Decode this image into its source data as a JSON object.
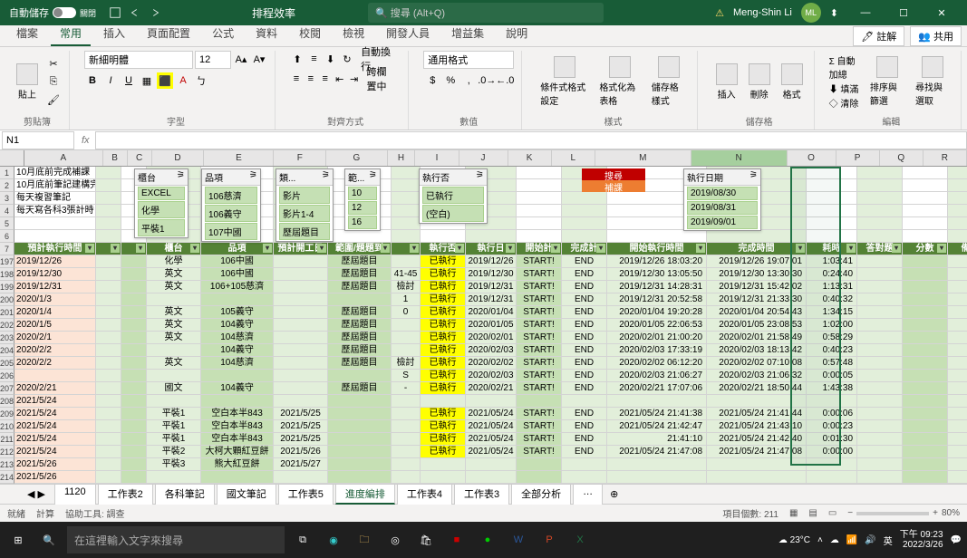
{
  "title": {
    "autosave": "自動儲存",
    "autosave_state": "關閉",
    "docname": "排程效率",
    "search": "搜尋 (Alt+Q)",
    "user": "Meng-Shin Li",
    "avatar": "ML"
  },
  "menutabs": [
    "檔案",
    "常用",
    "插入",
    "頁面配置",
    "公式",
    "資料",
    "校閱",
    "檢視",
    "開發人員",
    "增益集",
    "說明"
  ],
  "menuright": {
    "comment": "註解",
    "share": "共用"
  },
  "ribbon": {
    "clipboard": "剪貼簿",
    "paste": "貼上",
    "font_group": "字型",
    "font": "新細明體",
    "size": "12",
    "align_group": "對齊方式",
    "wrap": "自動換行",
    "merge": "跨欄置中",
    "number_group": "數值",
    "number_fmt": "通用格式",
    "styles_group": "樣式",
    "cond": "條件式格式設定",
    "tblfmt": "格式化為表格",
    "cellstyle": "儲存格樣式",
    "cells_group": "儲存格",
    "insert": "插入",
    "delete": "刪除",
    "format": "格式",
    "edit_group": "編輯",
    "autosum": "自動加總",
    "fill": "填滿",
    "clear": "清除",
    "sort": "排序與篩選",
    "find": "尋找與選取"
  },
  "namebox": "N1",
  "fx": "fx",
  "cols": [
    "A",
    "B",
    "C",
    "D",
    "E",
    "F",
    "G",
    "H",
    "I",
    "J",
    "K",
    "L",
    "M",
    "N",
    "O",
    "P",
    "Q",
    "R"
  ],
  "notes": [
    "10月底前完成補課",
    "10月底前筆記建構完",
    "每天複習筆記",
    "每天寫各科3張計時"
  ],
  "slicers": {
    "s1": {
      "title": "櫃台",
      "items": [
        "EXCEL",
        "化學",
        "平裝1"
      ]
    },
    "s2": {
      "title": "品項",
      "items": [
        "106慈濟",
        "106義守",
        "107中國"
      ]
    },
    "s3": {
      "title": "類...",
      "items": [
        "影片",
        "影片1-4",
        "歷屆題目"
      ]
    },
    "s4": {
      "title": "範...",
      "items": [
        "10",
        "12",
        "16"
      ]
    },
    "s5": {
      "title": "執行否",
      "items": [
        "已執行",
        "(空白)"
      ]
    },
    "s6": {
      "title": "執行日期",
      "items": [
        "2019/08/30",
        "2019/08/31",
        "2019/09/01"
      ]
    }
  },
  "red1": "搜尋",
  "red2": "補課",
  "headers": [
    "預計執行時間",
    "",
    "",
    "櫃台",
    "品項",
    "預計開工日",
    "範圍/題題到",
    "",
    "執行否",
    "執行日",
    "開始計",
    "完成計",
    "開始執行時間",
    "完成時間",
    "耗時",
    "答對題",
    "分數",
    "備註"
  ],
  "rownums": [
    "1",
    "2",
    "3",
    "4",
    "5",
    "6",
    "7",
    "197",
    "198",
    "199",
    "200",
    "201",
    "202",
    "203",
    "204",
    "205",
    "206",
    "207",
    "208",
    "209",
    "210",
    "211",
    "212",
    "213",
    "214"
  ],
  "rows": [
    {
      "a": "2019/12/26",
      "d": "化學",
      "e": "106中國",
      "f": "",
      "g": "歷屆題目",
      "h": "",
      "i": "已執行",
      "j": "2019/12/26",
      "k": "START!",
      "l": "END",
      "m": "2019/12/26 18:03:20",
      "n": "2019/12/26 19:07:01",
      "o": "1:03:41"
    },
    {
      "a": "2019/12/30",
      "d": "英文",
      "e": "106中國",
      "f": "",
      "g": "歷屆題目",
      "h": "41-45",
      "i": "已執行",
      "j": "2019/12/30",
      "k": "START!",
      "l": "END",
      "m": "2019/12/30 13:05:50",
      "n": "2019/12/30 13:30:30",
      "o": "0:24:40"
    },
    {
      "a": "2019/12/31",
      "d": "英文",
      "e": "106+105慈濟",
      "f": "",
      "g": "歷屆題目",
      "h": "檢討",
      "i": "已執行",
      "j": "2019/12/31",
      "k": "START!",
      "l": "END",
      "m": "2019/12/31 14:28:31",
      "n": "2019/12/31 15:42:02",
      "o": "1:13:31"
    },
    {
      "a": "2020/1/3",
      "d": "",
      "e": "",
      "f": "",
      "g": "",
      "h": "1",
      "i": "已執行",
      "j": "2019/12/31",
      "k": "START!",
      "l": "END",
      "m": "2019/12/31 20:52:58",
      "n": "2019/12/31 21:33:30",
      "o": "0:40:32"
    },
    {
      "a": "2020/1/4",
      "d": "英文",
      "e": "105義守",
      "f": "",
      "g": "歷屆題目",
      "h": "0",
      "i": "已執行",
      "j": "2020/01/04",
      "k": "START!",
      "l": "END",
      "m": "2020/01/04 19:20:28",
      "n": "2020/01/04 20:54:43",
      "o": "1:34:15"
    },
    {
      "a": "2020/1/5",
      "d": "英文",
      "e": "104義守",
      "f": "",
      "g": "歷屆題目",
      "h": "",
      "i": "已執行",
      "j": "2020/01/05",
      "k": "START!",
      "l": "END",
      "m": "2020/01/05 22:06:53",
      "n": "2020/01/05 23:08:53",
      "o": "1:02:00"
    },
    {
      "a": "2020/2/1",
      "d": "英文",
      "e": "104慈濟",
      "f": "",
      "g": "歷屆題目",
      "h": "",
      "i": "已執行",
      "j": "2020/02/01",
      "k": "START!",
      "l": "END",
      "m": "2020/02/01 21:00:20",
      "n": "2020/02/01 21:58:49",
      "o": "0:58:29"
    },
    {
      "a": "2020/2/2",
      "d": "",
      "e": "104義守",
      "f": "",
      "g": "歷屆題目",
      "h": "",
      "i": "已執行",
      "j": "2020/02/03",
      "k": "START!",
      "l": "END",
      "m": "2020/02/03 17:33:19",
      "n": "2020/02/03 18:13:42",
      "o": "0:40:23"
    },
    {
      "a": "2020/2/2",
      "d": "英文",
      "e": "104慈濟",
      "f": "",
      "g": "歷屆題目",
      "h": "檢討",
      "i": "已執行",
      "j": "2020/02/02",
      "k": "START!",
      "l": "END",
      "m": "2020/02/02 06:12:20",
      "n": "2020/02/02 07:10:08",
      "o": "0:57:48"
    },
    {
      "a": "",
      "d": "",
      "e": "",
      "f": "",
      "g": "",
      "h": "S",
      "i": "已執行",
      "j": "2020/02/03",
      "k": "START!",
      "l": "END",
      "m": "2020/02/03 21:06:27",
      "n": "2020/02/03 21:06:32",
      "o": "0:00:05"
    },
    {
      "a": "2020/2/21",
      "d": "國文",
      "e": "104義守",
      "f": "",
      "g": "歷屆題目",
      "h": "-",
      "i": "已執行",
      "j": "2020/02/21",
      "k": "START!",
      "l": "END",
      "m": "2020/02/21 17:07:06",
      "n": "2020/02/21 18:50:44",
      "o": "1:43:38"
    },
    {
      "a": "2021/5/24",
      "d": "",
      "e": "",
      "f": "",
      "g": "",
      "h": "",
      "i": "",
      "j": "",
      "k": "",
      "l": "",
      "m": "",
      "n": "",
      "o": ""
    },
    {
      "a": "2021/5/24",
      "d": "平裝1",
      "e": "空白本半843",
      "f": "2021/5/25",
      "g": "",
      "h": "",
      "i": "已執行",
      "j": "2021/05/24",
      "k": "START!",
      "l": "END",
      "m": "2021/05/24 21:41:38",
      "n": "2021/05/24 21:41:44",
      "o": "0:00:06"
    },
    {
      "a": "2021/5/24",
      "d": "平裝1",
      "e": "空白本半843",
      "f": "2021/5/25",
      "g": "",
      "h": "",
      "i": "已執行",
      "j": "2021/05/24",
      "k": "START!",
      "l": "END",
      "m": "2021/05/24 21:42:47",
      "n": "2021/05/24 21:43:10",
      "o": "0:00:23"
    },
    {
      "a": "2021/5/24",
      "d": "平裝1",
      "e": "空白本半843",
      "f": "2021/5/25",
      "g": "",
      "h": "",
      "i": "已執行",
      "j": "2021/05/24",
      "k": "START!",
      "l": "END",
      "m": "21:41:10",
      "n": "2021/05/24 21:42:40",
      "o": "0:01:30"
    },
    {
      "a": "2021/5/24",
      "d": "平裝2",
      "e": "大柯大顆紅豆餅",
      "f": "2021/5/26",
      "g": "",
      "h": "",
      "i": "已執行",
      "j": "2021/05/24",
      "k": "START!",
      "l": "END",
      "m": "2021/05/24 21:47:08",
      "n": "2021/05/24 21:47:08",
      "o": "0:00:00"
    },
    {
      "a": "2021/5/26",
      "d": "平裝3",
      "e": "熊大紅豆餅",
      "f": "2021/5/27",
      "g": "",
      "h": "",
      "i": "",
      "j": "",
      "k": "",
      "l": "",
      "m": "",
      "n": "",
      "o": ""
    },
    {
      "a": "2021/5/26",
      "d": "",
      "e": "",
      "f": "",
      "g": "",
      "h": "",
      "i": "",
      "j": "",
      "k": "",
      "l": "",
      "m": "",
      "n": "",
      "o": ""
    }
  ],
  "sheets": [
    "1120",
    "工作表2",
    "各科筆記",
    "國文筆記",
    "工作表5",
    "進度編排",
    "工作表4",
    "工作表3",
    "全部分析",
    "…"
  ],
  "active_sheet": 5,
  "status": {
    "ready": "就緒",
    "calc": "計算",
    "access": "協助工具: 調查",
    "count_lbl": "項目個數:",
    "count": "211",
    "zoom": "80%"
  },
  "taskbar": {
    "search": "在這裡輸入文字來搜尋",
    "weather": "23°C",
    "ime": "英",
    "time": "下午 09:23",
    "date": "2022/3/26"
  }
}
